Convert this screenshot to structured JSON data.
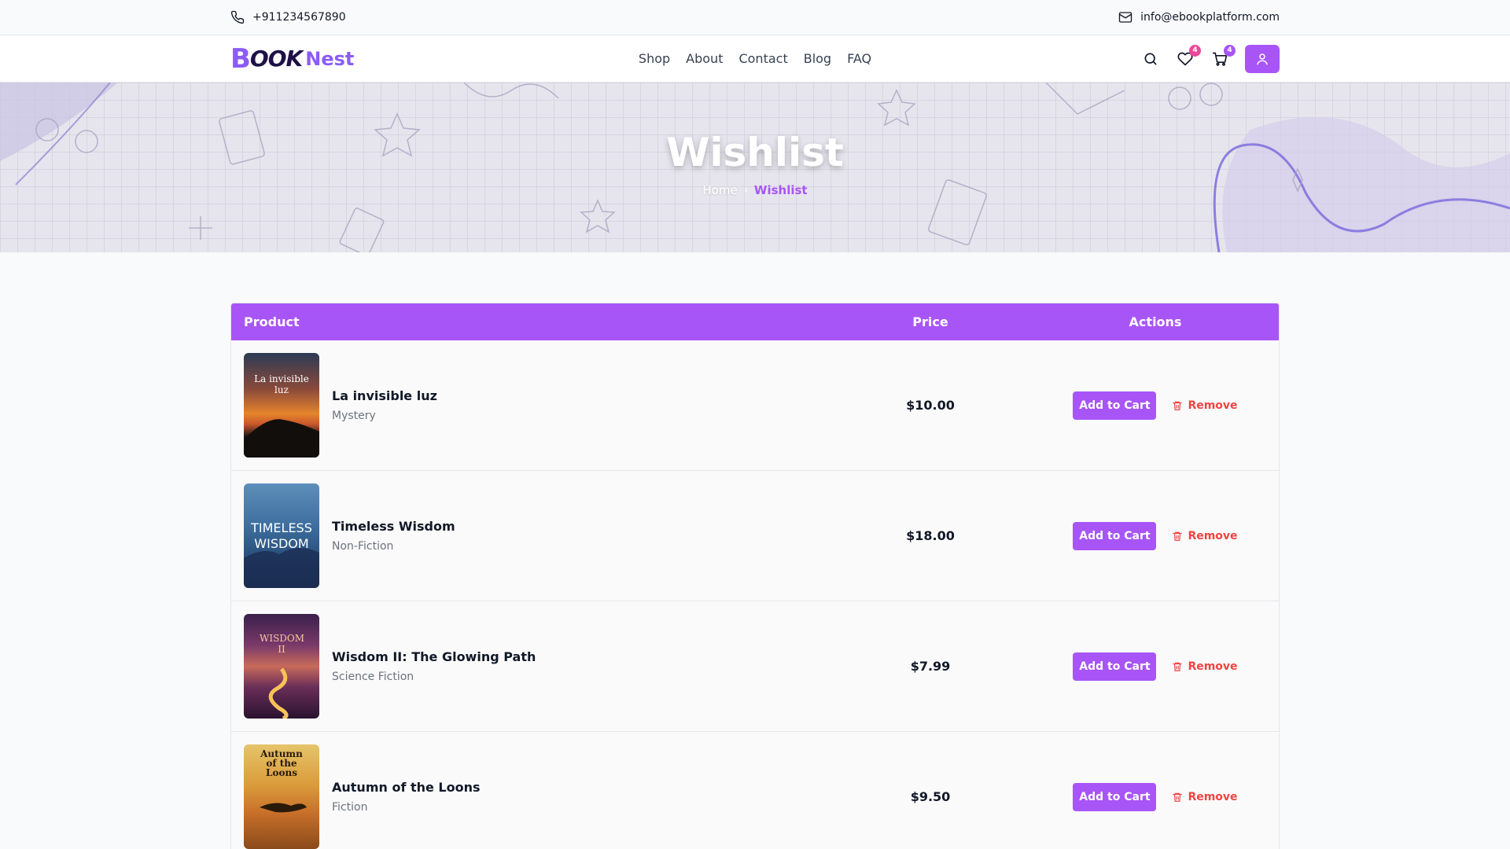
{
  "topbar": {
    "phone": "+911234567890",
    "email": "info@ebookplatform.com"
  },
  "header": {
    "logo": {
      "part1": "B",
      "part2": "OOK",
      "part3": "Nest"
    },
    "nav": [
      "Shop",
      "About",
      "Contact",
      "Blog",
      "FAQ"
    ],
    "wishlist_count": "4",
    "cart_count": "4"
  },
  "hero": {
    "title": "Wishlist",
    "breadcrumb_home": "Home",
    "breadcrumb_current": "Wishlist"
  },
  "table": {
    "headers": {
      "product": "Product",
      "price": "Price",
      "actions": "Actions"
    },
    "add_label": "Add to Cart",
    "remove_label": "Remove",
    "rows": [
      {
        "title": "La invisible luz",
        "category": "Mystery",
        "price": "$10.00",
        "cover_text": "La invisible luz"
      },
      {
        "title": "Timeless Wisdom",
        "category": "Non-Fiction",
        "price": "$18.00",
        "cover_text": "TIMELESS WISDOM"
      },
      {
        "title": "Wisdom II: The Glowing Path",
        "category": "Science Fiction",
        "price": "$7.99",
        "cover_text": "WISDOM II"
      },
      {
        "title": "Autumn of the Loons",
        "category": "Fiction",
        "price": "$9.50",
        "cover_text": "Autumn of the Loons"
      }
    ]
  },
  "colors": {
    "accent": "#a855f7",
    "danger": "#ef4444",
    "badge_pink": "#ec4899"
  }
}
